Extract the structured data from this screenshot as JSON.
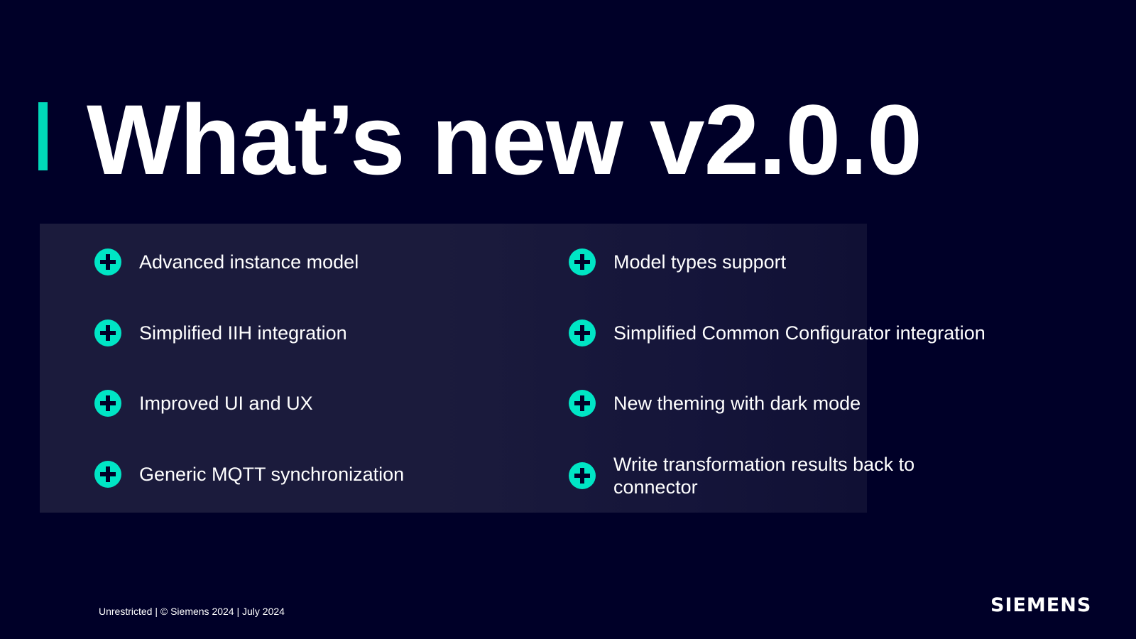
{
  "slide": {
    "title": "What’s new v2.0.0",
    "features": [
      {
        "icon": "plus-circle-icon",
        "label": "Advanced instance model"
      },
      {
        "icon": "plus-circle-icon",
        "label": "Simplified IIH integration"
      },
      {
        "icon": "plus-circle-icon",
        "label": "Improved UI and UX"
      },
      {
        "icon": "plus-circle-icon",
        "label": "Generic MQTT synchronization"
      },
      {
        "icon": "plus-circle-icon",
        "label": "Model types support"
      },
      {
        "icon": "plus-circle-icon",
        "label": "Simplified Common Configurator integration"
      },
      {
        "icon": "plus-circle-icon",
        "label": "New theming with dark mode"
      },
      {
        "icon": "plus-circle-icon",
        "label": "Write transformation results back to connector"
      }
    ]
  },
  "footer": {
    "text": "Unrestricted | © Siemens 2024 | July 2024",
    "logo": "SIEMENS"
  },
  "colors": {
    "background": "#000028",
    "accent": "#00d7b9",
    "panel": "#1b1b3c",
    "text": "#ffffff"
  }
}
